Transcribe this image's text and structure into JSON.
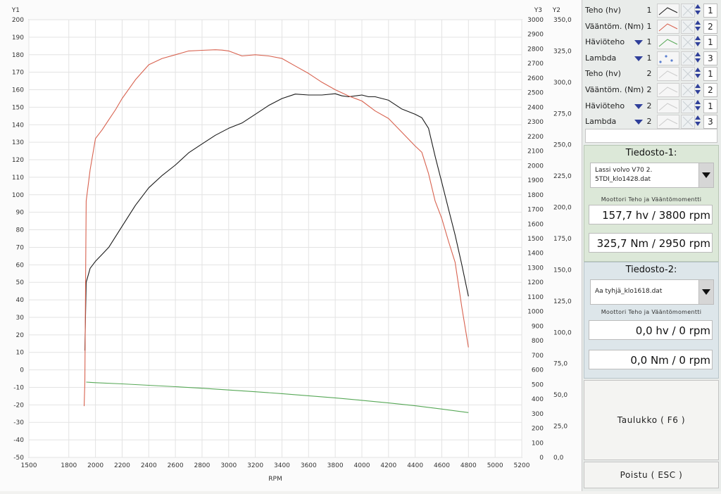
{
  "chart_data": {
    "type": "line",
    "xlabel": "RPM",
    "x_range": [
      1500,
      5200
    ],
    "x_ticks": [
      1500,
      1800,
      2000,
      2200,
      2400,
      2600,
      2800,
      3000,
      3200,
      3400,
      3600,
      3800,
      4000,
      4200,
      4400,
      4600,
      4800,
      5000,
      5200
    ],
    "grid": true,
    "axes": {
      "y1": {
        "label": "Y1",
        "range": [
          -50,
          200
        ],
        "ticks": [
          -50,
          -40,
          -30,
          -20,
          -10,
          0,
          10,
          20,
          30,
          40,
          50,
          60,
          70,
          80,
          90,
          100,
          110,
          120,
          130,
          140,
          150,
          160,
          170,
          180,
          190,
          200
        ]
      },
      "y3": {
        "label": "Y3",
        "range": [
          0,
          3000
        ],
        "ticks": [
          0,
          100,
          200,
          300,
          400,
          500,
          600,
          700,
          800,
          900,
          1000,
          1100,
          1200,
          1300,
          1400,
          1500,
          1600,
          1700,
          1800,
          1900,
          2000,
          2100,
          2200,
          2300,
          2400,
          2500,
          2600,
          2700,
          2800,
          2900,
          3000
        ]
      },
      "y2": {
        "label": "Y2",
        "range": [
          0,
          350
        ],
        "ticks": [
          "0,0",
          "25,0",
          "50,0",
          "75,0",
          "100,0",
          "125,0",
          "150,0",
          "175,0",
          "200,0",
          "225,0",
          "250,0",
          "275,0",
          "300,0",
          "325,0",
          "350,0"
        ]
      }
    },
    "series": [
      {
        "name": "Teho (hv)",
        "axis": "y1",
        "color": "#1a1a1a",
        "x": [
          1920,
          1930,
          1960,
          2000,
          2050,
          2100,
          2200,
          2300,
          2400,
          2500,
          2600,
          2700,
          2800,
          2900,
          3000,
          3100,
          3200,
          3300,
          3400,
          3500,
          3600,
          3700,
          3800,
          3850,
          3900,
          4000,
          4050,
          4100,
          4200,
          4300,
          4400,
          4450,
          4500,
          4550,
          4600,
          4650,
          4700,
          4750,
          4800
        ],
        "y": [
          11,
          50,
          58,
          62,
          66,
          70,
          82,
          94,
          104,
          111,
          117,
          124,
          129,
          134,
          138,
          141,
          146,
          151,
          155,
          157.5,
          157,
          157,
          157.7,
          156.5,
          156,
          157,
          156,
          156,
          154,
          149,
          146,
          144,
          138,
          122,
          107,
          92,
          77,
          60,
          42
        ]
      },
      {
        "name": "Vääntöm. (Nm)",
        "axis": "y2",
        "color": "#d8624f",
        "x": [
          1915,
          1920,
          1930,
          1960,
          2000,
          2050,
          2100,
          2150,
          2200,
          2300,
          2400,
          2500,
          2600,
          2700,
          2800,
          2900,
          2950,
          3000,
          3100,
          3200,
          3300,
          3400,
          3500,
          3600,
          3700,
          3800,
          3900,
          4000,
          4100,
          4200,
          4300,
          4400,
          4450,
          4500,
          4550,
          4600,
          4650,
          4700,
          4750,
          4800
        ],
        "y": [
          41,
          60,
          205,
          230,
          255,
          262,
          270,
          278,
          287,
          302,
          314,
          319,
          322,
          325,
          325.5,
          326,
          325.7,
          325,
          321,
          322,
          321,
          319,
          313,
          307,
          300,
          294,
          289,
          285,
          277,
          271,
          260,
          249,
          244,
          227,
          205,
          191,
          173,
          156,
          120,
          88
        ]
      },
      {
        "name": "Häviöteho",
        "axis": "y1",
        "color": "#57a857",
        "x": [
          1930,
          2000,
          2200,
          2400,
          2600,
          2800,
          3000,
          3200,
          3400,
          3600,
          3800,
          4000,
          4200,
          4400,
          4600,
          4800
        ],
        "y": [
          -7,
          -7.3,
          -8,
          -8.8,
          -9.6,
          -10.5,
          -11.5,
          -12.5,
          -13.6,
          -14.8,
          -16,
          -17.4,
          -18.9,
          -20.5,
          -22.4,
          -24.4
        ]
      }
    ]
  },
  "legend": [
    {
      "name": "Teho (hv)",
      "file": "1",
      "dropdown": false,
      "axis": "1",
      "swatch_color": "#1a1a1a",
      "swatch": "line",
      "disabled": false
    },
    {
      "name": "Vääntöm. (Nm)",
      "file": "1",
      "dropdown": false,
      "axis": "2",
      "swatch_color": "#d8624f",
      "swatch": "line",
      "disabled": false
    },
    {
      "name": "Häviöteho",
      "file": "1",
      "dropdown": true,
      "axis": "1",
      "swatch_color": "#57a857",
      "swatch": "line",
      "disabled": false
    },
    {
      "name": "Lambda",
      "file": "1",
      "dropdown": true,
      "axis": "3",
      "swatch_color": "#5a7ed0",
      "swatch": "dots",
      "disabled": false
    },
    {
      "name": "Teho (hv)",
      "file": "2",
      "dropdown": false,
      "axis": "1",
      "swatch_color": "#cccccc",
      "swatch": "line",
      "disabled": true
    },
    {
      "name": "Vääntöm. (Nm)",
      "file": "2",
      "dropdown": false,
      "axis": "2",
      "swatch_color": "#cccccc",
      "swatch": "line",
      "disabled": true
    },
    {
      "name": "Häviöteho",
      "file": "2",
      "dropdown": true,
      "axis": "1",
      "swatch_color": "#cccccc",
      "swatch": "line",
      "disabled": true
    },
    {
      "name": "Lambda",
      "file": "2",
      "dropdown": true,
      "axis": "3",
      "swatch_color": "#cccccc",
      "swatch": "line",
      "disabled": true
    }
  ],
  "file1": {
    "title": "Tiedosto-1:",
    "selected_file": "Lassi volvo V70 2.\n5TDI_klo1428.dat",
    "subtitle": "Moottori Teho ja Vääntömomentti",
    "power": "157,7 hv / 3800 rpm",
    "torque": "325,7 Nm / 2950 rpm"
  },
  "file2": {
    "title": "Tiedosto-2:",
    "selected_file": "Aa tyhjä_klo1618.dat",
    "subtitle": "Moottori Teho ja Vääntömomentti",
    "power": "0,0 hv / 0 rpm",
    "torque": "0,0 Nm / 0 rpm"
  },
  "buttons": {
    "table": "Taulukko ( F6 )",
    "exit": "Poistu ( ESC )"
  },
  "colors": {
    "panel1": "#dce8d8",
    "panel2": "#dde6ea",
    "dropdown_arrow": "#2f3f9a"
  }
}
